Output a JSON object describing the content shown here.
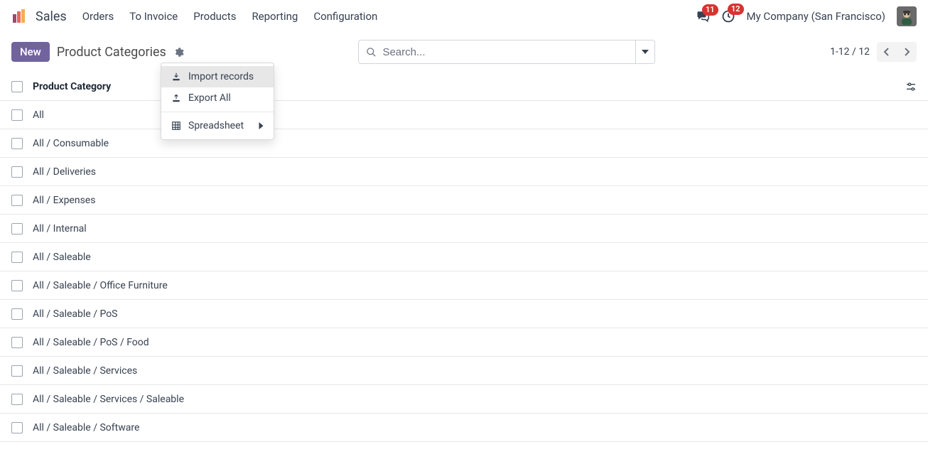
{
  "app_name": "Sales",
  "nav": [
    "Orders",
    "To Invoice",
    "Products",
    "Reporting",
    "Configuration"
  ],
  "messaging_badge": "11",
  "activities_badge": "12",
  "company_name": "My Company (San Francisco)",
  "new_button": "New",
  "breadcrumb_title": "Product Categories",
  "search_placeholder": "Search...",
  "pager": "1-12 / 12",
  "header_column": "Product Category",
  "rows": [
    "All",
    "All / Consumable",
    "All / Deliveries",
    "All / Expenses",
    "All / Internal",
    "All / Saleable",
    "All / Saleable / Office Furniture",
    "All / Saleable / PoS",
    "All / Saleable / PoS / Food",
    "All / Saleable / Services",
    "All / Saleable / Services / Saleable",
    "All / Saleable / Software"
  ],
  "dropdown": {
    "import": "Import records",
    "export": "Export All",
    "spreadsheet": "Spreadsheet"
  }
}
